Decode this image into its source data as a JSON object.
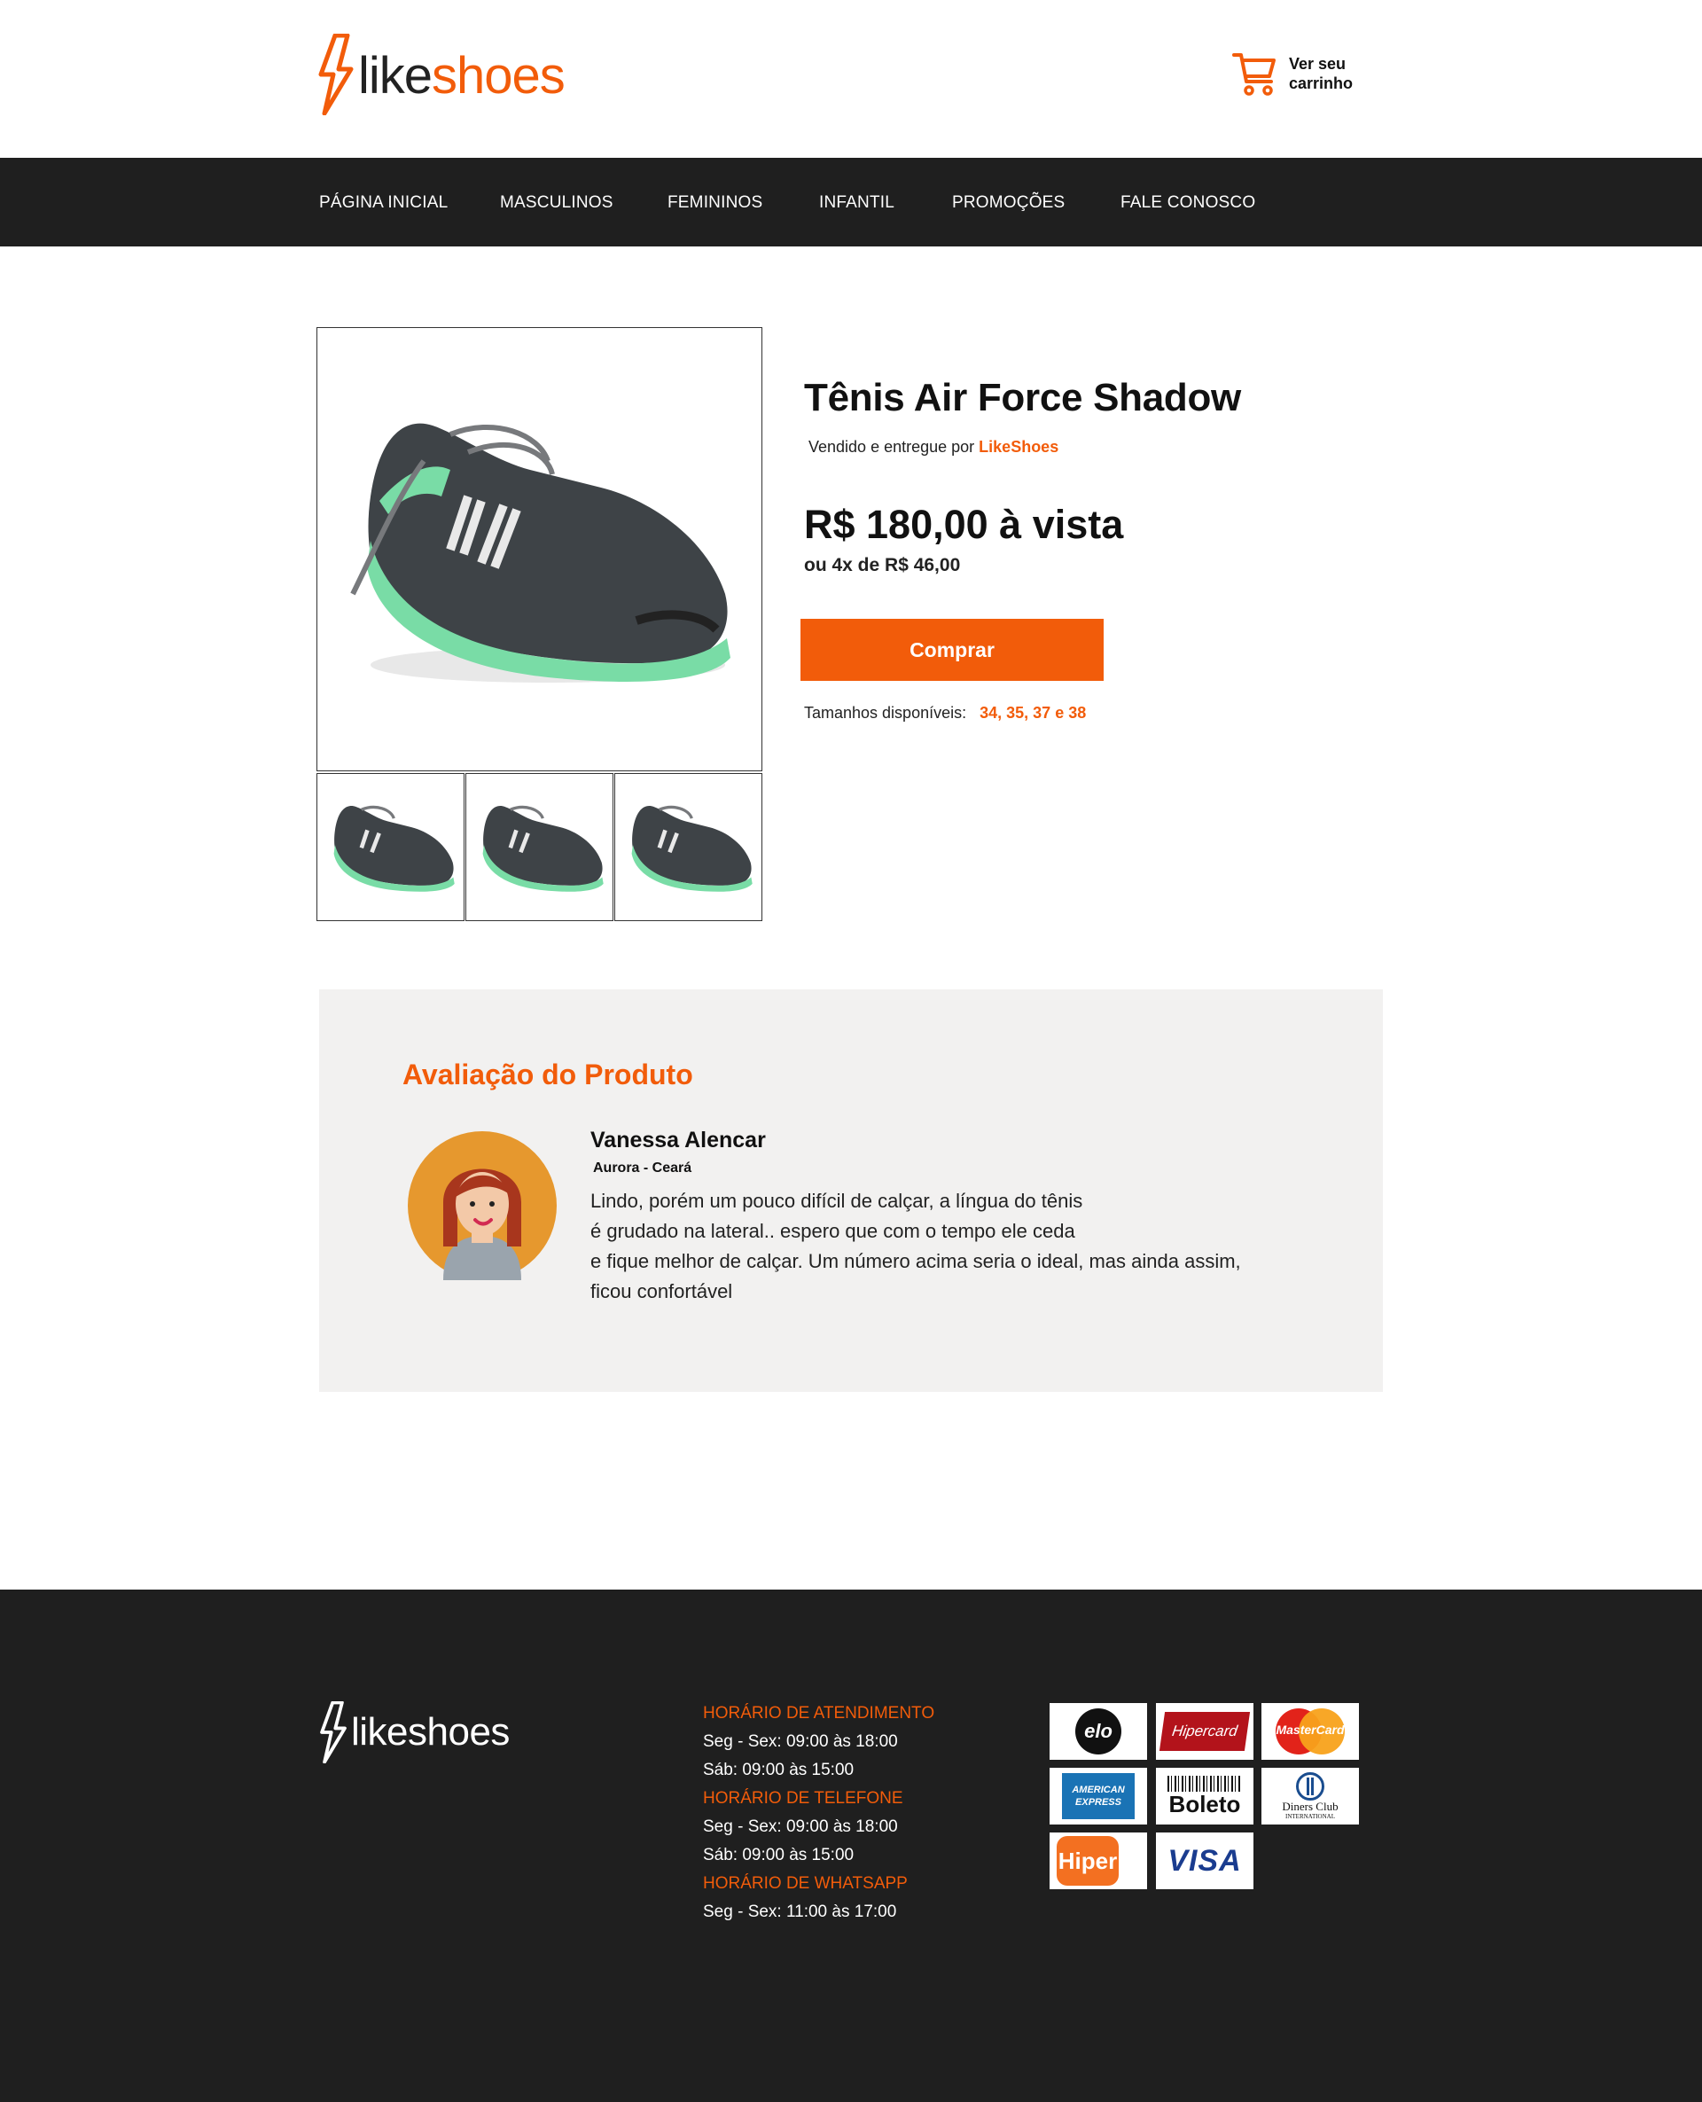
{
  "brand": {
    "name_part1": "like",
    "name_part2": "shoes",
    "footer_name": "likeshoes",
    "accent_color": "#f25c0a",
    "dark_color": "#1f1f1f"
  },
  "header": {
    "cart_icon": "shopping-cart-icon",
    "cart_label_line1": "Ver seu",
    "cart_label_line2": "carrinho"
  },
  "nav": {
    "items": [
      {
        "label": "PÁGINA INICIAL"
      },
      {
        "label": "MASCULINOS"
      },
      {
        "label": "FEMININOS"
      },
      {
        "label": "INFANTIL"
      },
      {
        "label": "PROMOÇÕES"
      },
      {
        "label": "FALE CONOSCO"
      }
    ]
  },
  "product": {
    "title": "Tênis Air Force Shadow",
    "sold_by_prefix": "Vendido e entregue por",
    "sold_by_brand": "LikeShoes",
    "price": "R$ 180,00 à vista",
    "installments": "ou 4x de R$ 46,00",
    "buy_label": "Comprar",
    "sizes_label": "Tamanhos disponíveis:",
    "sizes_values": "34, 35, 37 e 38"
  },
  "review": {
    "section_title": "Avaliação do Produto",
    "name": "Vanessa Alencar",
    "location": "Aurora - Ceará",
    "lines": [
      "Lindo, porém um pouco difícil de calçar, a língua do tênis",
      "é grudado na lateral.. espero que com o tempo ele ceda",
      "e fique melhor de calçar. Um número acima seria o ideal, mas ainda assim,",
      "ficou confortável"
    ]
  },
  "footer": {
    "hours": [
      {
        "heading": "HORÁRIO DE ATENDIMENTO",
        "lines": [
          "Seg - Sex: 09:00 às 18:00",
          "Sáb: 09:00 às 15:00"
        ]
      },
      {
        "heading": "HORÁRIO DE TELEFONE",
        "lines": [
          "Seg - Sex: 09:00 às 18:00",
          "Sáb: 09:00 às 15:00"
        ]
      },
      {
        "heading": "HORÁRIO DE WHATSAPP",
        "lines": [
          "Seg - Sex: 11:00 às 17:00"
        ]
      }
    ],
    "payments": {
      "elo": "elo",
      "hipercard": "Hipercard",
      "mastercard": "MasterCard",
      "amex_line1": "AMERICAN",
      "amex_line2": "EXPRESS",
      "boleto": "Boleto",
      "diners_line1": "Diners Club",
      "diners_line2": "INTERNATIONAL",
      "hiper": "Hiper",
      "visa": "VISA"
    }
  }
}
